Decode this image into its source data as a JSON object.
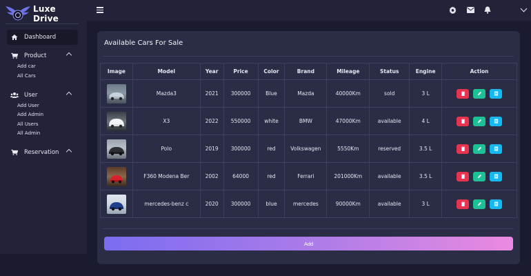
{
  "brand": {
    "name": "Luxe Drive"
  },
  "sidebar": {
    "dashboard": "Dashboard",
    "product": {
      "label": "Product",
      "items": [
        "Add car",
        "All Cars"
      ]
    },
    "user": {
      "label": "User",
      "items": [
        "Add User",
        "Add Admin",
        "All Users",
        "All Admin"
      ]
    },
    "reservation": {
      "label": "Reservation"
    }
  },
  "topbar": {
    "icons": [
      "settings-icon",
      "mail-icon",
      "bell-icon",
      "chevron-down-icon"
    ]
  },
  "main": {
    "title": "Available Cars For Sale",
    "add_label": "Add",
    "columns": [
      "Image",
      "Model",
      "Year",
      "Price",
      "Color",
      "Brand",
      "Mileage",
      "Status",
      "Engine",
      "Action"
    ],
    "rows": [
      {
        "model": "Mazda3",
        "year": "2021",
        "price": "300000",
        "color": "Blue",
        "brand": "Mazda",
        "mileage": "40000Km",
        "status": "sold",
        "engine": "3 L"
      },
      {
        "model": "X3",
        "year": "2022",
        "price": "550000",
        "color": "white",
        "brand": "BMW",
        "mileage": "47000Km",
        "status": "available",
        "engine": "4 L"
      },
      {
        "model": "Polo",
        "year": "2019",
        "price": "300000",
        "color": "red",
        "brand": "Volkswagen",
        "mileage": "5550Km",
        "status": "reserved",
        "engine": "3.5 L"
      },
      {
        "model": "F360 Modena Ber",
        "year": "2002",
        "price": "64000",
        "color": "red",
        "brand": "Ferrari",
        "mileage": "201000Km",
        "status": "available",
        "engine": "3.5 L"
      },
      {
        "model": "mercedes-benz c",
        "year": "2020",
        "price": "300000",
        "color": "blue",
        "brand": "mercedes",
        "mileage": "90000Km",
        "status": "available",
        "engine": "3 L"
      }
    ]
  },
  "colors": {
    "background": "#1a1b2e",
    "panel": "#222339",
    "card": "#2b2d47",
    "delete": "#e8334f",
    "edit": "#1fbf98",
    "view": "#16b8f0",
    "accent": "#7b6cf0"
  }
}
